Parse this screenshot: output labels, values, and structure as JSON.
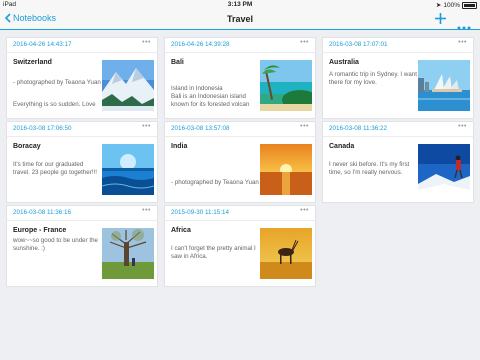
{
  "status": {
    "carrier": "iPad",
    "time": "3:13 PM",
    "battery": "100%"
  },
  "nav": {
    "back_label": "Notebooks",
    "title": "Travel"
  },
  "notes": [
    {
      "date": "2016-04-26 14:43:17",
      "title": "Switzerland",
      "body": "- photographed by Teaona Yuan",
      "body2": "Everything is so sudden. Love",
      "image": "snowy-mountains"
    },
    {
      "date": "2016-04-26 14:39:28",
      "title": "Bali",
      "body": "Island in Indonesia\nBali is an Indonesian island known for its forested volcan",
      "image": "tropical-beach"
    },
    {
      "date": "2016-03-08 17:07:01",
      "title": "Australia",
      "body": "A romantic trip in Sydney. I want there for my love.",
      "image": "sydney-opera-house"
    },
    {
      "date": "2016-03-08 17:06:50",
      "title": "Boracay",
      "body": "It's time for our graduated travel. 23 people go together!!!",
      "image": "ocean-waves"
    },
    {
      "date": "2016-03-08 13:57:08",
      "title": "India",
      "body": "- photographed by Teaona Yuan",
      "image": "sunset-sea"
    },
    {
      "date": "2016-03-08 11:36:22",
      "title": "Canada",
      "body": "I never ski before. It's my first time, so I'm really nervous.",
      "image": "skier-snow"
    },
    {
      "date": "2016-03-08 11:36:16",
      "title": "Europe - France",
      "body": "wow~~so good to be under the sunshine. :)",
      "image": "tree-field"
    },
    {
      "date": "2015-09-30 11:15:14",
      "title": "Africa",
      "body": "I can't forget the pretty animal I saw in Africa.",
      "image": "antelope-savanna"
    }
  ]
}
